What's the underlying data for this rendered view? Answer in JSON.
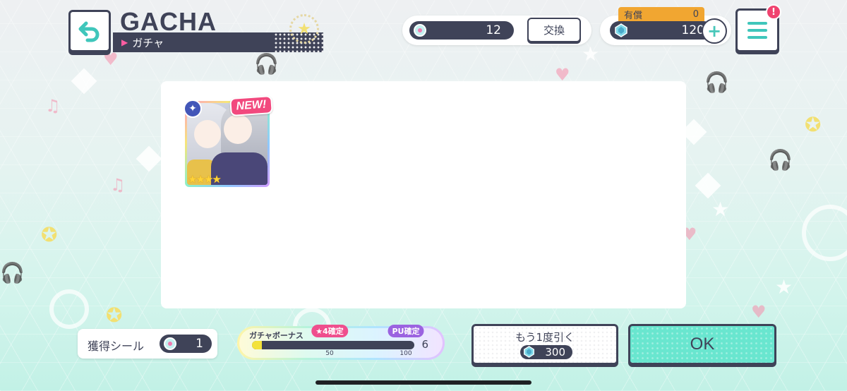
{
  "header": {
    "title": "GACHA",
    "subtitle": "ガチャ"
  },
  "seal_counter": {
    "value": "12",
    "exchange_label": "交換"
  },
  "star_counter": {
    "paid_label": "有償",
    "paid_value": "0",
    "value": "120"
  },
  "result": {
    "card": {
      "new_badge": "NEW!",
      "rarity_stars": 4,
      "stars_text": "★★★★"
    }
  },
  "earned_seals": {
    "label": "獲得シール",
    "value": "1"
  },
  "gacha_bonus": {
    "title": "ガチャボーナス",
    "tag_4star": "★4確定",
    "tag_pu": "PU確定",
    "mark_50": "50",
    "mark_100": "100",
    "current": "6",
    "progress_fraction": 0.06
  },
  "buttons": {
    "again_label": "もう1度引く",
    "again_cost": "300",
    "ok_label": "OK"
  },
  "colors": {
    "navy": "#3f4358",
    "accent_mint": "#69e6cf",
    "accent_pink": "#f2497e",
    "paid_orange": "#f1a631"
  },
  "icons": [
    "back-arrow-icon",
    "seal-icon",
    "star-gem-icon",
    "plus-icon",
    "menu-icon",
    "alert-icon",
    "attribute-icon"
  ]
}
